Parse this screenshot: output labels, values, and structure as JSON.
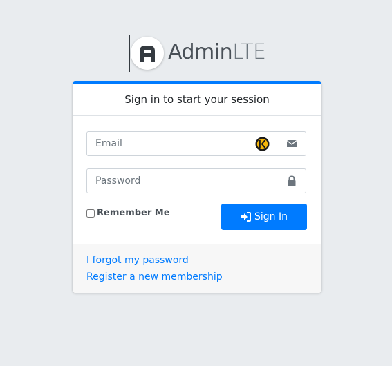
{
  "brand": {
    "name_bold": "Admin",
    "name_light": "LTE",
    "logo_icon": "adminlte-logo-icon"
  },
  "login": {
    "message": "Sign in to start your session",
    "email": {
      "placeholder": "Email",
      "value": "",
      "icon": "envelope-icon",
      "extension_icon": "keeper-icon"
    },
    "password": {
      "placeholder": "Password",
      "value": "",
      "icon": "lock-icon"
    },
    "remember_label": "Remember Me",
    "remember_checked": false,
    "sign_in_label": "Sign In",
    "sign_in_icon": "sign-in-icon"
  },
  "links": {
    "forgot_password": "I forgot my password",
    "register": "Register a new membership"
  },
  "colors": {
    "accent": "#007bff",
    "background": "#e9ecef"
  }
}
